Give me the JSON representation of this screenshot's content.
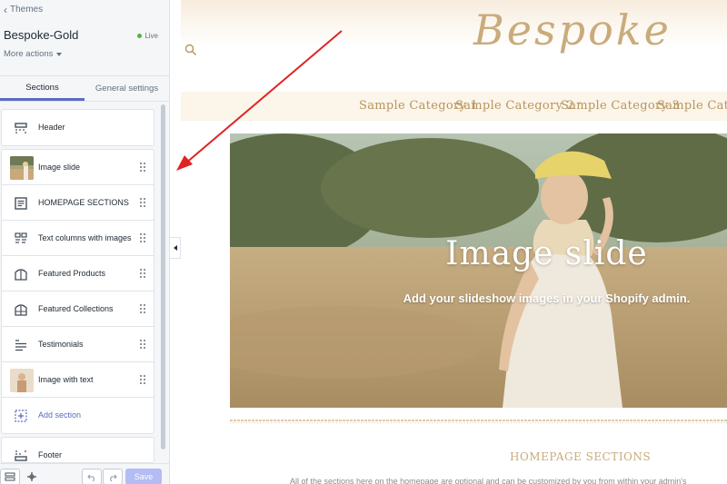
{
  "sidebar": {
    "back_label": "Themes",
    "theme_name": "Bespoke-Gold",
    "status": "Live",
    "more_actions": "More actions",
    "tabs": [
      {
        "label": "Sections",
        "active": true
      },
      {
        "label": "General settings",
        "active": false
      }
    ],
    "header_item": {
      "label": "Header",
      "icon": "header-layout-icon"
    },
    "items": [
      {
        "label": "Image slide",
        "icon": "image-thumbnail"
      },
      {
        "label": "HOMEPAGE SECTIONS",
        "icon": "text-block-icon"
      },
      {
        "label": "Text columns with images",
        "icon": "columns-icon"
      },
      {
        "label": "Featured Products",
        "icon": "product-icon"
      },
      {
        "label": "Featured Collections",
        "icon": "collection-icon"
      },
      {
        "label": "Testimonials",
        "icon": "list-icon"
      },
      {
        "label": "Image with text",
        "icon": "image-thumbnail"
      },
      {
        "label": "Add section",
        "icon": "add-section-icon"
      }
    ],
    "footer_item": {
      "label": "Footer",
      "icon": "footer-layout-icon"
    },
    "save_label": "Save",
    "accent_color": "#5c6ac4",
    "live_color": "#50b83c"
  },
  "preview": {
    "logo": "Bespoke",
    "nav": [
      "Sample Category 1",
      "Sample Category 2",
      "Sample Category 3",
      "Sample Categor"
    ],
    "hero_title": "Image slide",
    "hero_subtitle": "Add your slideshow images in your Shopify admin.",
    "section_heading": "HOMEPAGE SECTIONS",
    "section_text": "All of the sections here on the homepage are optional and can be customized by you from within your admin's",
    "brand_color": "#c9ab7c"
  },
  "annotation": {
    "color": "#e02424"
  }
}
